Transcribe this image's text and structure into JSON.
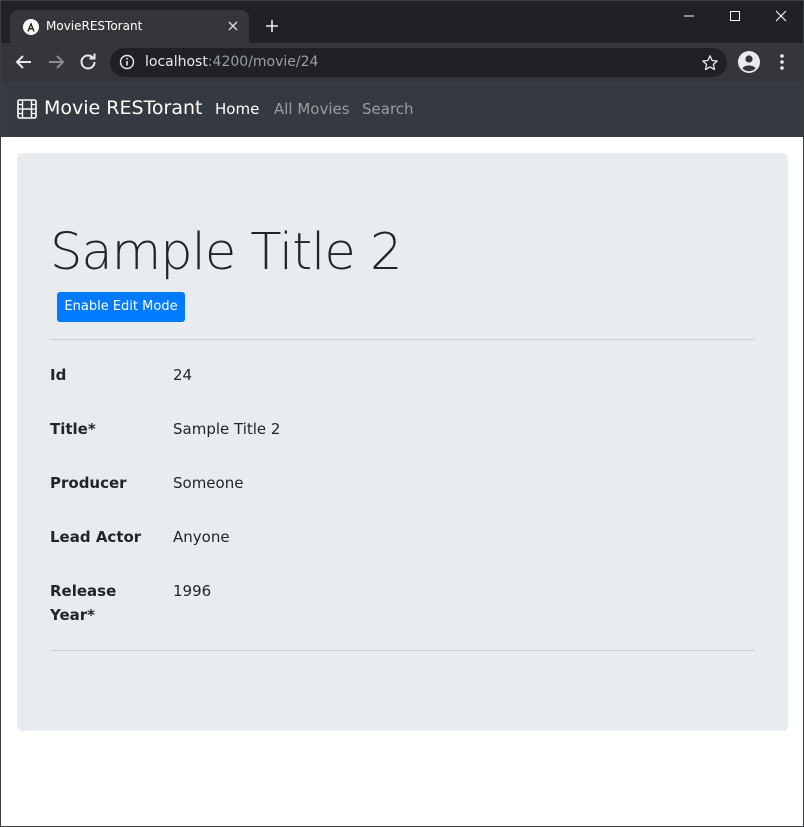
{
  "browser": {
    "tab_title": "MovieRESTorant",
    "tab_close_icon": "×",
    "url_host": "localhost",
    "url_rest": ":4200/movie/24"
  },
  "navbar": {
    "brand": "Movie RESTorant",
    "links": [
      "Home",
      "All Movies",
      "Search"
    ],
    "active_link": "Home"
  },
  "movie": {
    "title": "Sample Title 2",
    "edit_button_label": "Enable Edit Mode",
    "fields": [
      {
        "label": "Id",
        "value": "24"
      },
      {
        "label": "Title*",
        "value": "Sample Title 2"
      },
      {
        "label": "Producer",
        "value": "Someone"
      },
      {
        "label": "Lead Actor",
        "value": "Anyone"
      },
      {
        "label": "Release Year*",
        "value": "1996"
      }
    ]
  },
  "colors": {
    "navbar_bg": "#343a40",
    "primary": "#007bff",
    "jumbotron_bg": "#e9ecef"
  },
  "icons": [
    "angular-logo-icon",
    "close-icon",
    "plus-icon",
    "minimize-icon",
    "maximize-icon",
    "window-close-icon",
    "back-icon",
    "forward-icon",
    "reload-icon",
    "site-info-icon",
    "star-icon",
    "profile-icon",
    "menu-icon",
    "film-icon"
  ]
}
